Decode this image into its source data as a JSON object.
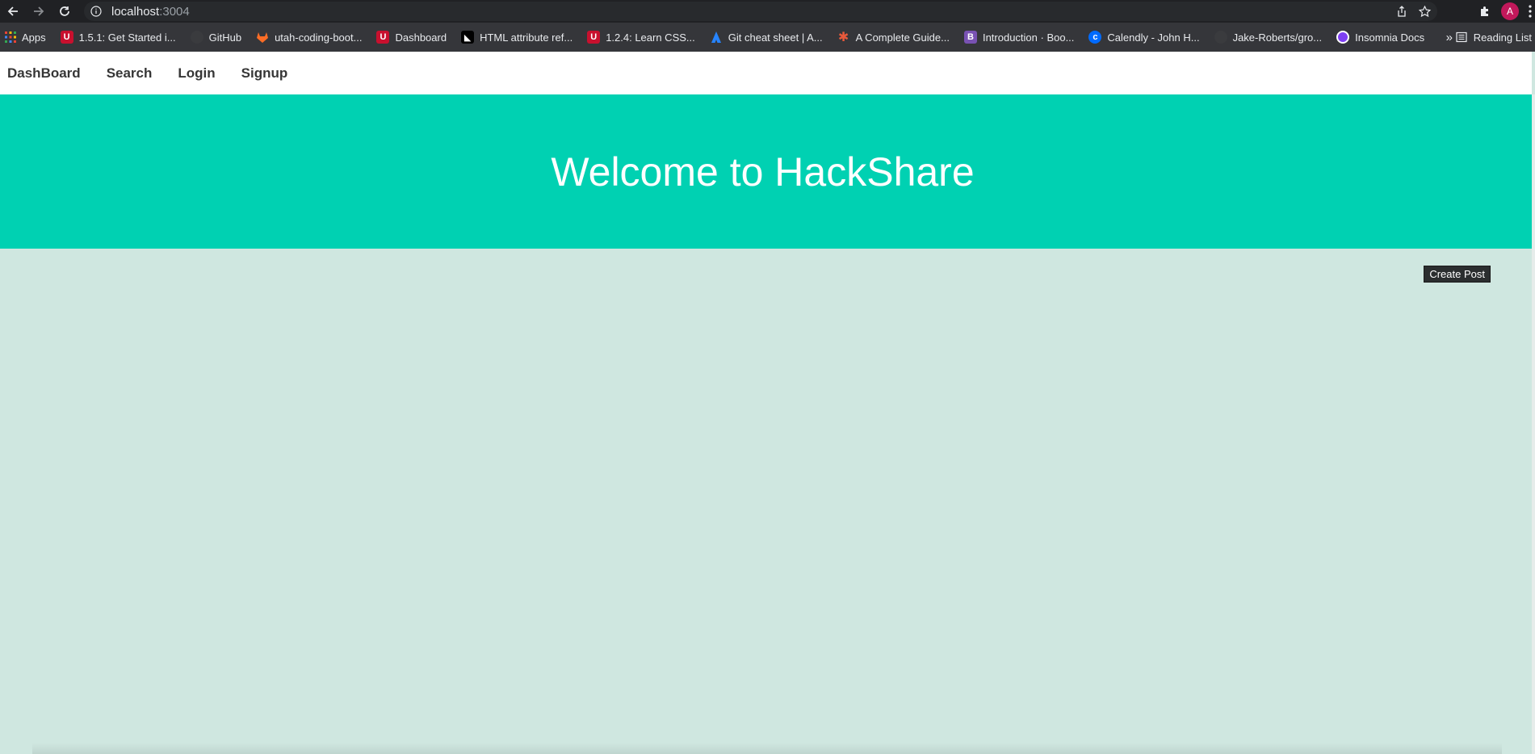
{
  "browser": {
    "url_host": "localhost",
    "url_port": ":3004",
    "profile_initial": "A",
    "bookmarks_more": "»",
    "reading_list": "Reading List",
    "bookmarks": [
      {
        "label": "Apps",
        "icon": "apps-grid-icon",
        "color": "#ea4335"
      },
      {
        "label": "1.5.1: Get Started i...",
        "icon": "utah-u-icon",
        "color": "#c8102e"
      },
      {
        "label": "GitHub",
        "icon": "github-icon",
        "color": "#555555"
      },
      {
        "label": "utah-coding-boot...",
        "icon": "gitlab-icon",
        "color": "#fc6d26"
      },
      {
        "label": "Dashboard",
        "icon": "utah-u-icon",
        "color": "#c8102e"
      },
      {
        "label": "HTML attribute ref...",
        "icon": "mdn-icon",
        "color": "#000000"
      },
      {
        "label": "1.2.4: Learn CSS...",
        "icon": "utah-u-icon",
        "color": "#c8102e"
      },
      {
        "label": "Git cheat sheet | A...",
        "icon": "atlassian-icon",
        "color": "#2684ff"
      },
      {
        "label": "A Complete Guide...",
        "icon": "css-tricks-icon",
        "color": "#e8593b"
      },
      {
        "label": "Introduction · Boo...",
        "icon": "bootstrap-icon",
        "color": "#7952b3"
      },
      {
        "label": "Calendly - John H...",
        "icon": "calendly-icon",
        "color": "#006bff"
      },
      {
        "label": "Jake-Roberts/gro...",
        "icon": "github-icon",
        "color": "#555555"
      },
      {
        "label": "Insomnia Docs",
        "icon": "insomnia-icon",
        "color": "#7e3ff2"
      }
    ]
  },
  "site": {
    "nav": [
      "DashBoard",
      "Search",
      "Login",
      "Signup"
    ],
    "hero_title": "Welcome to HackShare",
    "create_post_label": "Create Post"
  },
  "colors": {
    "hero": "#00d1b2",
    "page_background": "#cfe7e0",
    "button": "#2b2e2f"
  }
}
